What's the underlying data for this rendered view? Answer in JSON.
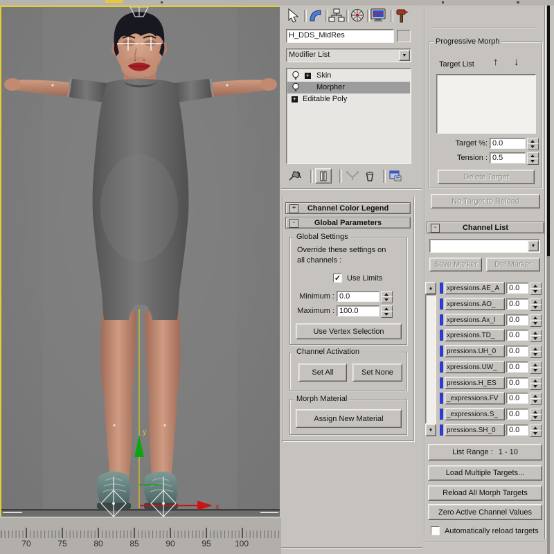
{
  "colors": {
    "viewport_border": "#e3cf35",
    "panel_bg": "#c6c3bf",
    "channel_bar_blue": "#2a3bd8",
    "axis_x_red": "#c81414",
    "axis_y_green": "#12a312",
    "gizmo_yellow": "#d6c51e"
  },
  "viewport": {
    "axis_x_label": "x",
    "axis_y_label": "y",
    "ruler_labels": [
      "70",
      "75",
      "80",
      "85",
      "90",
      "95",
      "100"
    ]
  },
  "panel": {
    "tabs": [
      "create",
      "modify",
      "hierarchy",
      "motion",
      "display",
      "utilities"
    ],
    "object_name": "H_DDS_MidRes",
    "modifier_list_label": "Modifier List",
    "stack": {
      "skin": "Skin",
      "morpher": "Morpher",
      "editable_poly": "Editable Poly"
    },
    "stack_tools": [
      "pin-stack",
      "show-end-result",
      "make-unique",
      "remove-modifier",
      "configure-modifier-sets"
    ]
  },
  "rollouts": {
    "ccl_state": "+",
    "ccl_title": "Channel Color Legend",
    "gp_state": "-",
    "gp_title": "Global Parameters"
  },
  "global_settings": {
    "title": "Global Settings",
    "line1": "Override these settings on",
    "line2": "all channels :",
    "use_limits_label": "Use Limits",
    "use_limits_mark": "✓",
    "min_label": "Minimum :",
    "min_value": "0.0",
    "max_label": "Maximum :",
    "max_value": "100.0",
    "use_vertex_selection": "Use Vertex Selection"
  },
  "channel_activation": {
    "title": "Channel Activation",
    "set_all": "Set All",
    "set_none": "Set None"
  },
  "morph_material": {
    "title": "Morph Material",
    "assign": "Assign New Material"
  },
  "progressive_morph": {
    "title": "Progressive Morph",
    "target_list_label": "Target List",
    "up_arrow": "↑",
    "down_arrow": "↓",
    "target_pct_label": "Target %:",
    "target_pct_value": "0.0",
    "tension_label": "Tension :",
    "tension_value": "0.5",
    "delete_target": "Delete Target",
    "no_target": "No Target to Reload"
  },
  "channel_list": {
    "state": "-",
    "title": "Channel List",
    "marker_dropdown_value": "",
    "save_marker": "Save Marker",
    "del_marker": "Del Marker",
    "rows": [
      {
        "name": "xpressions.AE_A",
        "value": "0.0"
      },
      {
        "name": "xpressions.AO_",
        "value": "0.0"
      },
      {
        "name": "xpressions.Ax_l",
        "value": "0.0"
      },
      {
        "name": "xpressions.TD_",
        "value": "0.0"
      },
      {
        "name": "pressions.UH_0",
        "value": "0.0"
      },
      {
        "name": "xpressions.UW_",
        "value": "0.0"
      },
      {
        "name": "pressions.H_ES",
        "value": "0.0"
      },
      {
        "name": "_expressions.FV",
        "value": "0.0"
      },
      {
        "name": "_expressions.S_",
        "value": "0.0"
      },
      {
        "name": "pressions.SH_0",
        "value": "0.0"
      }
    ],
    "list_range_label": "List Range :",
    "list_range_value": "1 - 10",
    "load_multiple": "Load Multiple Targets...",
    "reload_all": "Reload All Morph Targets",
    "zero_active": "Zero Active Channel Values",
    "auto_reload_label": "Automatically reload targets",
    "auto_reload_mark": ""
  }
}
